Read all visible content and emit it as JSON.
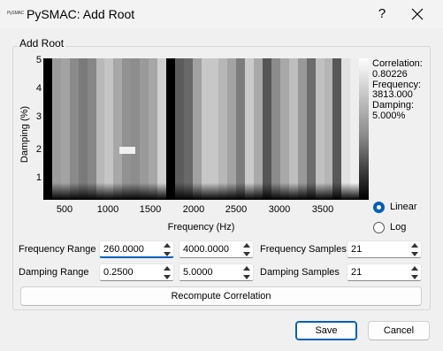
{
  "window": {
    "title": "PySMAC: Add Root",
    "app_icon_text": "PySMAC",
    "help_label": "?"
  },
  "group": {
    "title": "Add Root"
  },
  "chart_data": {
    "type": "heatmap",
    "xlabel": "Frequency (Hz)",
    "ylabel": "Damping (%)",
    "x_ticks": [
      "500",
      "1000",
      "1500",
      "2000",
      "2500",
      "3000",
      "3500"
    ],
    "y_ticks": [
      "5",
      "4",
      "3",
      "2",
      "1"
    ],
    "xlim": [
      260,
      4000
    ],
    "ylim": [
      0.25,
      5.0
    ],
    "colormap": "gray",
    "column_shades": [
      "#000000",
      "#9c9c9c",
      "#a3a3a3",
      "#8a8a8a",
      "#7a7a7a",
      "#878787",
      "#b8b8b8",
      "#c5c5c5",
      "#a8a8a8",
      "#929292",
      "#8d8d8d",
      "#9a9a9a",
      "#a6a6a6",
      "#cfcfcf",
      "#000000",
      "#5c5c5c",
      "#696969",
      "#a1a1a1",
      "#c7c7c7",
      "#c7c7c7",
      "#b7b7b7",
      "#a3a3a3",
      "#7c7c7c",
      "#cacaca",
      "#a9a9a9",
      "#555555",
      "#8b8b8b",
      "#a8a8a8",
      "#bebebe",
      "#999999",
      "#6c6c6c",
      "#c0c0c0",
      "#b5b5b5",
      "#585858",
      "#e1e1e1",
      "#eeeeee"
    ],
    "highlight_cell": {
      "frequency": 1260,
      "damping": 1.9,
      "shade": "#f0f0f0"
    }
  },
  "readout": {
    "correlation_label": "Correlation:",
    "correlation_value": "0.80226",
    "frequency_label": "Frequency:",
    "frequency_value": "3813.000",
    "damping_label": "Damping:",
    "damping_value": "5.000%"
  },
  "scale": {
    "options": [
      "Linear",
      "Log"
    ],
    "selected": "Linear"
  },
  "controls": {
    "frequency_range_label": "Frequency Range",
    "frequency_min": "260.0000",
    "frequency_max": "4000.0000",
    "frequency_samples_label": "Frequency Samples",
    "frequency_samples": "21",
    "damping_range_label": "Damping Range",
    "damping_min": "0.2500",
    "damping_max": "5.0000",
    "damping_samples_label": "Damping Samples",
    "damping_samples": "21"
  },
  "buttons": {
    "recompute": "Recompute Correlation",
    "save": "Save",
    "cancel": "Cancel"
  },
  "colors": {
    "accent": "#005fb8",
    "window_bg": "#f0f0f0"
  }
}
